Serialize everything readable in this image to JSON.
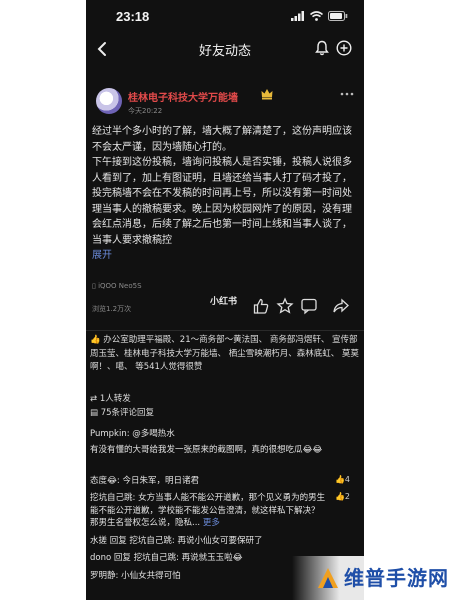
{
  "status_bar": {
    "time": "23:18"
  },
  "nav": {
    "title": "好友动态"
  },
  "post": {
    "author": "桂林电子科技大学万能墙",
    "time": "今天20:22",
    "paragraph1": "经过半个多小时的了解，墙大概了解清楚了，这份声明应该不会太严谨，因为墙随心打的。",
    "paragraph2": "下午接到这份投稿，墙询问投稿人是否实锤，投稿人说很多人看到了，加上有图证明，且墙还给当事人打了码才投了，投完稿墙不会在不发稿的时间再上号，所以没有第一时间处理当事人的撤稿要求。晚上因为校园网炸了的原因，没有理会红点消息，后续了解之后也第一时间上线和当事人谈了，当事人要求撤稿控",
    "expand": "展开",
    "device": "iQOO Neo5S",
    "views": "浏览1.2万次",
    "watermark": "小红书"
  },
  "likes_text": "办公室助理平福殿、21～商务部～黄法国、 商务部冯熠轩、 宣传部周玉莹、桂林电子科技大学万能墙、 栖尘雪映潮朽月、森林底虹、 莫莫啊！、噶、 等541人觉得很赞",
  "stats": {
    "shares": "1人转发",
    "comments": "75条评论回复"
  },
  "comments": [
    {
      "text": "Pumpkin: @多喝热水",
      "likes": ""
    },
    {
      "text": "有没有懂的大哥给我发一张原来的截图啊，真的很想吃瓜😂😂",
      "likes": ""
    },
    {
      "text": "态度😂: 今日朱军，明日诸君",
      "likes": "4"
    },
    {
      "text": "挖坑自己跳: 女方当事人能不能公开道歉，那个见义勇为的男生能不能公开道歉，学校能不能发公告澄清，就这样私下解决？ 那男生名誉权怎么说，隐私...",
      "more": "更多",
      "likes": "2"
    },
    {
      "text": "水搓 回复 挖坑自己跳: 再说小仙女可要保研了",
      "likes": ""
    },
    {
      "text": "dono 回复 挖坑自己跳: 再说就玉玉啦😂",
      "likes": ""
    },
    {
      "text": "罗明静: 小仙女共得可怕",
      "likes": ""
    }
  ],
  "banner": {
    "text": "维普手游网"
  }
}
